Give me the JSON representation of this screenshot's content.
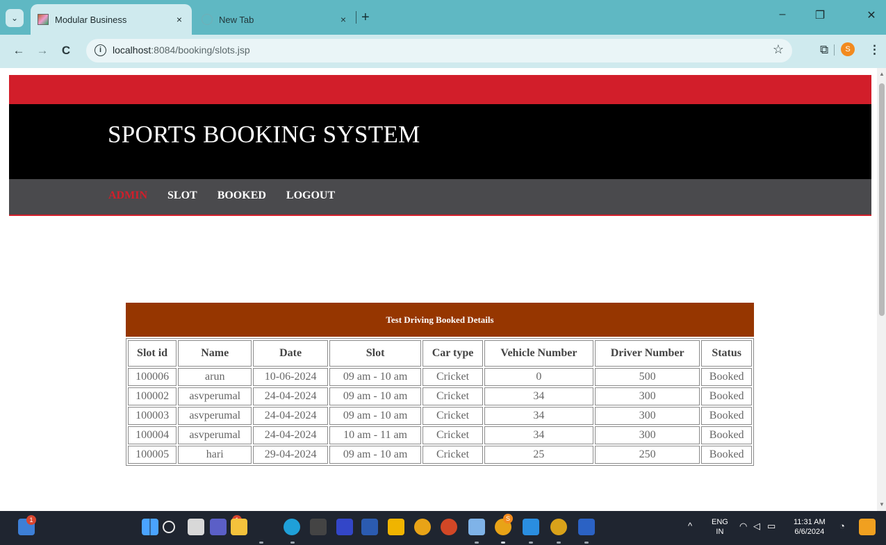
{
  "browser": {
    "tabs": [
      {
        "title": "Modular Business",
        "close": "×"
      },
      {
        "title": "New Tab",
        "close": "×"
      }
    ],
    "new_tab": "+",
    "window_controls": {
      "minimize": "–",
      "restore": "❐",
      "close": "✕"
    },
    "nav": {
      "back": "←",
      "forward": "→",
      "reload": "C"
    },
    "address": {
      "info": "i",
      "host": "localhost",
      "path": ":8084/booking/slots.jsp"
    },
    "star": "☆",
    "extensions": "⧉",
    "profile_initial": "S",
    "menu": "⋮"
  },
  "site": {
    "title": "SPORTS BOOKING SYSTEM",
    "menu": [
      {
        "label": "ADMIN",
        "active": true
      },
      {
        "label": "SLOT",
        "active": false
      },
      {
        "label": "BOOKED",
        "active": false
      },
      {
        "label": "LOGOUT",
        "active": false
      }
    ]
  },
  "table": {
    "caption": "Test Driving Booked Details",
    "headers": [
      "Slot id",
      "Name",
      "Date",
      "Slot",
      "Car type",
      "Vehicle Number",
      "Driver Number",
      "Status"
    ],
    "rows": [
      [
        "100006",
        "arun",
        "10-06-2024",
        "09 am - 10 am",
        "Cricket",
        "0",
        "500",
        "Booked"
      ],
      [
        "100002",
        "asvperumal",
        "24-04-2024",
        "09 am - 10 am",
        "Cricket",
        "34",
        "300",
        "Booked"
      ],
      [
        "100003",
        "asvperumal",
        "24-04-2024",
        "09 am - 10 am",
        "Cricket",
        "34",
        "300",
        "Booked"
      ],
      [
        "100004",
        "asvperumal",
        "24-04-2024",
        "10 am - 11 am",
        "Cricket",
        "34",
        "300",
        "Booked"
      ],
      [
        "100005",
        "hari",
        "29-04-2024",
        "09 am - 10 am",
        "Cricket",
        "25",
        "250",
        "Booked"
      ]
    ]
  },
  "taskbar": {
    "notification_badge": "1",
    "teams_badge": "1",
    "chrome_badge": "S",
    "tray": {
      "caret": "^",
      "lang_top": "ENG",
      "lang_bottom": "IN",
      "time": "11:31 AM",
      "date": "6/6/2024"
    }
  },
  "colors": {
    "tab_strip": "#5fb8c3",
    "toolbar": "#cfeaee",
    "red_band": "#d21e2a",
    "menu_band": "#4a4a4d",
    "caption_bg": "#963600"
  }
}
